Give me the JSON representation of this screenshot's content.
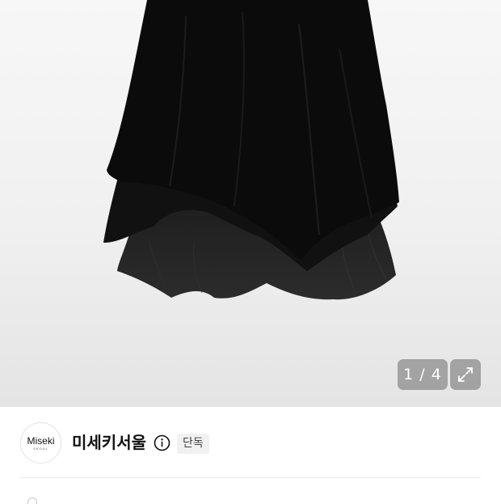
{
  "gallery": {
    "current": "1",
    "separator": " / ",
    "total": "4",
    "expand_icon": "expand-icon"
  },
  "brand": {
    "logo_text": "Miseki",
    "logo_sub": "SEOUL",
    "name": "미세키서울",
    "info_icon": "info-icon",
    "badge": "단독"
  },
  "colors": {
    "skirt": "#0b0b0b",
    "overlay": "#969696",
    "badge_bg": "#f1f1f1"
  }
}
